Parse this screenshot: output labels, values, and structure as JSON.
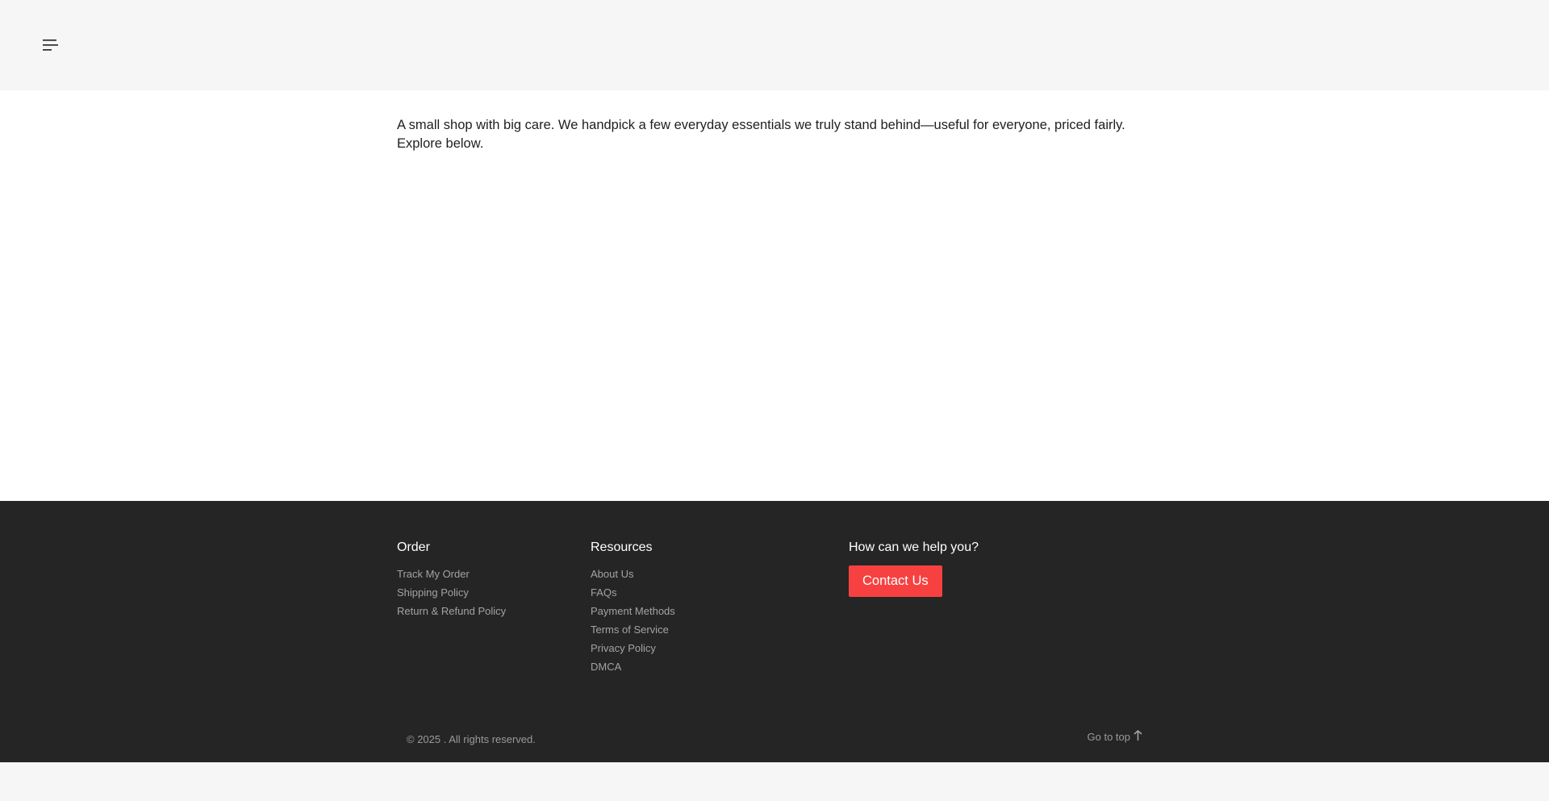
{
  "header": {
    "menu_icon": "menu-icon"
  },
  "main": {
    "intro_text": "A small shop with big care. We handpick a few everyday essentials we truly stand behind—useful for everyone, priced fairly. Explore below."
  },
  "footer": {
    "order": {
      "title": "Order",
      "links": [
        "Track My Order",
        "Shipping Policy",
        "Return & Refund Policy"
      ]
    },
    "resources": {
      "title": "Resources",
      "links": [
        "About Us",
        "FAQs",
        "Payment Methods",
        "Terms of Service",
        "Privacy Policy",
        "DMCA"
      ]
    },
    "help": {
      "title": "How can we help you?",
      "button_label": "Contact Us"
    },
    "copyright": "© 2025 . All rights reserved.",
    "go_to_top": "Go to top",
    "go_to_top_icon": "arrow-up-icon"
  },
  "colors": {
    "accent": "#f74141",
    "footer_bg": "#252525",
    "header_bg": "#f6f6f6",
    "main_bg": "#ffffff"
  }
}
